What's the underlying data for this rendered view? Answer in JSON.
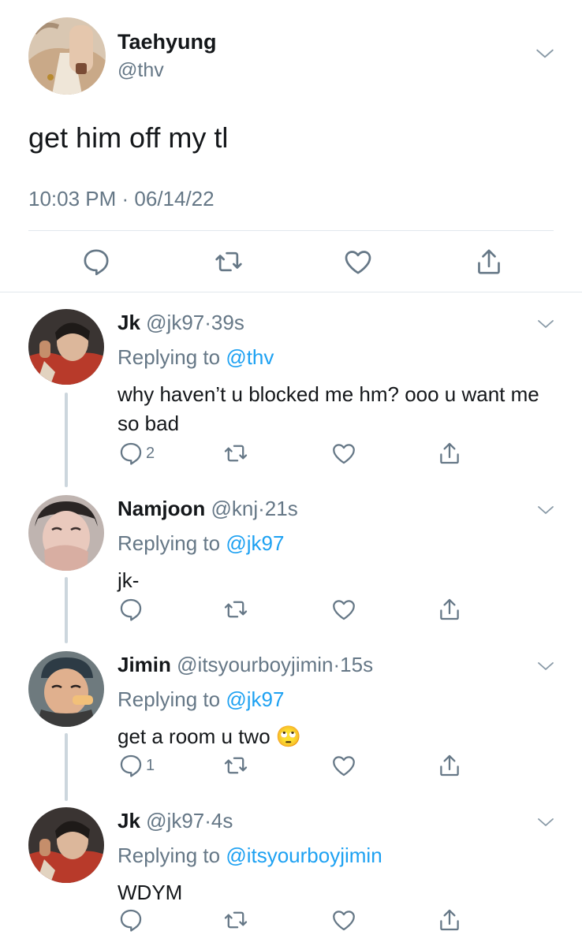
{
  "main_tweet": {
    "author_name": "Taehyung",
    "author_handle": "@thv",
    "text": "get him off my tl",
    "timestamp": "10:03 PM · 06/14/22",
    "avatar": "avatar-taehyung"
  },
  "replies": [
    {
      "name": "Jk",
      "handle": "@jk97",
      "dot": "·",
      "time": "39s",
      "replying_prefix": "Replying to ",
      "replying_to": "@thv",
      "text": "why haven’t u blocked me hm? ooo u want me so bad",
      "reply_count": "2",
      "avatar": "avatar-jk"
    },
    {
      "name": "Namjoon",
      "handle": "@knj",
      "dot": "·",
      "time": "21s",
      "replying_prefix": "Replying to ",
      "replying_to": "@jk97",
      "text": "jk-",
      "reply_count": "",
      "avatar": "avatar-namjoon"
    },
    {
      "name": "Jimin",
      "handle": "@itsyourboyjimin",
      "dot": "·",
      "time": "15s",
      "replying_prefix": "Replying to ",
      "replying_to": "@jk97",
      "text": "get a room u two",
      "emoji": "🙄",
      "reply_count": "1",
      "avatar": "avatar-jimin"
    },
    {
      "name": "Jk",
      "handle": "@jk97",
      "dot": "·",
      "time": "4s",
      "replying_prefix": "Replying to ",
      "replying_to": "@itsyourboyjimin",
      "text": "WDYM",
      "reply_count": "",
      "avatar": "avatar-jk"
    }
  ],
  "icons": {
    "reply": "reply-icon",
    "retweet": "retweet-icon",
    "like": "like-icon",
    "share": "share-icon",
    "more": "chevron-down-icon"
  },
  "colors": {
    "text": "#14171a",
    "secondary": "#657786",
    "link": "#1da1f2",
    "divider": "#e1e8ed",
    "thread_line": "#ccd6dd"
  }
}
